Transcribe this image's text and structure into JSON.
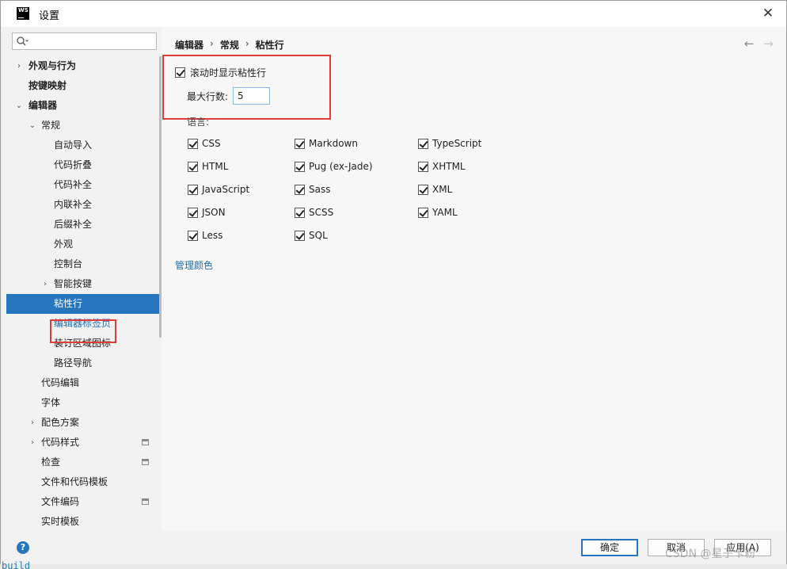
{
  "window": {
    "app_icon_text": "WS",
    "title": "设置",
    "close_glyph": "✕"
  },
  "search": {
    "value": "",
    "icon": "search-icon"
  },
  "sidebar": {
    "items": [
      {
        "label": "外观与行为",
        "arrow": "›"
      },
      {
        "label": "按键映射"
      },
      {
        "label": "编辑器",
        "arrow": "⌄"
      },
      {
        "label": "常规",
        "arrow": "⌄"
      },
      {
        "label": "自动导入"
      },
      {
        "label": "代码折叠"
      },
      {
        "label": "代码补全"
      },
      {
        "label": "内联补全"
      },
      {
        "label": "后缀补全"
      },
      {
        "label": "外观"
      },
      {
        "label": "控制台"
      },
      {
        "label": "智能按键",
        "arrow": "›"
      },
      {
        "label": "粘性行"
      },
      {
        "label": "编辑器标签页"
      },
      {
        "label": "装订区域图标"
      },
      {
        "label": "路径导航"
      },
      {
        "label": "代码编辑"
      },
      {
        "label": "字体"
      },
      {
        "label": "配色方案",
        "arrow": "›"
      },
      {
        "label": "代码样式",
        "arrow": "›"
      },
      {
        "label": "检查"
      },
      {
        "label": "文件和代码模板"
      },
      {
        "label": "文件编码"
      },
      {
        "label": "实时模板"
      }
    ]
  },
  "breadcrumb": {
    "part1": "编辑器",
    "part2": "常规",
    "part3": "粘性行",
    "sep": "›"
  },
  "nav": {
    "back": "←",
    "forward": "→"
  },
  "settings": {
    "show_sticky_label": "滚动时显示粘性行",
    "show_sticky_checked": true,
    "max_lines_label": "最大行数:",
    "max_lines_value": "5",
    "languages_label": "语言:",
    "languages": [
      {
        "name": "CSS",
        "checked": true
      },
      {
        "name": "HTML",
        "checked": true
      },
      {
        "name": "JavaScript",
        "checked": true
      },
      {
        "name": "JSON",
        "checked": true
      },
      {
        "name": "Less",
        "checked": true
      },
      {
        "name": "Markdown",
        "checked": true
      },
      {
        "name": "Pug (ex-Jade)",
        "checked": true
      },
      {
        "name": "Sass",
        "checked": true
      },
      {
        "name": "SCSS",
        "checked": true
      },
      {
        "name": "SQL",
        "checked": true
      },
      {
        "name": "TypeScript",
        "checked": true
      },
      {
        "name": "XHTML",
        "checked": true
      },
      {
        "name": "XML",
        "checked": true
      },
      {
        "name": "YAML",
        "checked": true
      }
    ],
    "manage_colors": "管理颜色"
  },
  "footer": {
    "help": "?",
    "ok": "确定",
    "cancel": "取消",
    "apply": "应用(A)"
  },
  "watermark": "CSDN @星子卡粉",
  "background_text": "build",
  "colors": {
    "selection": "#2675bf",
    "link": "#2470b3",
    "highlight_box": "#e33b3b"
  }
}
